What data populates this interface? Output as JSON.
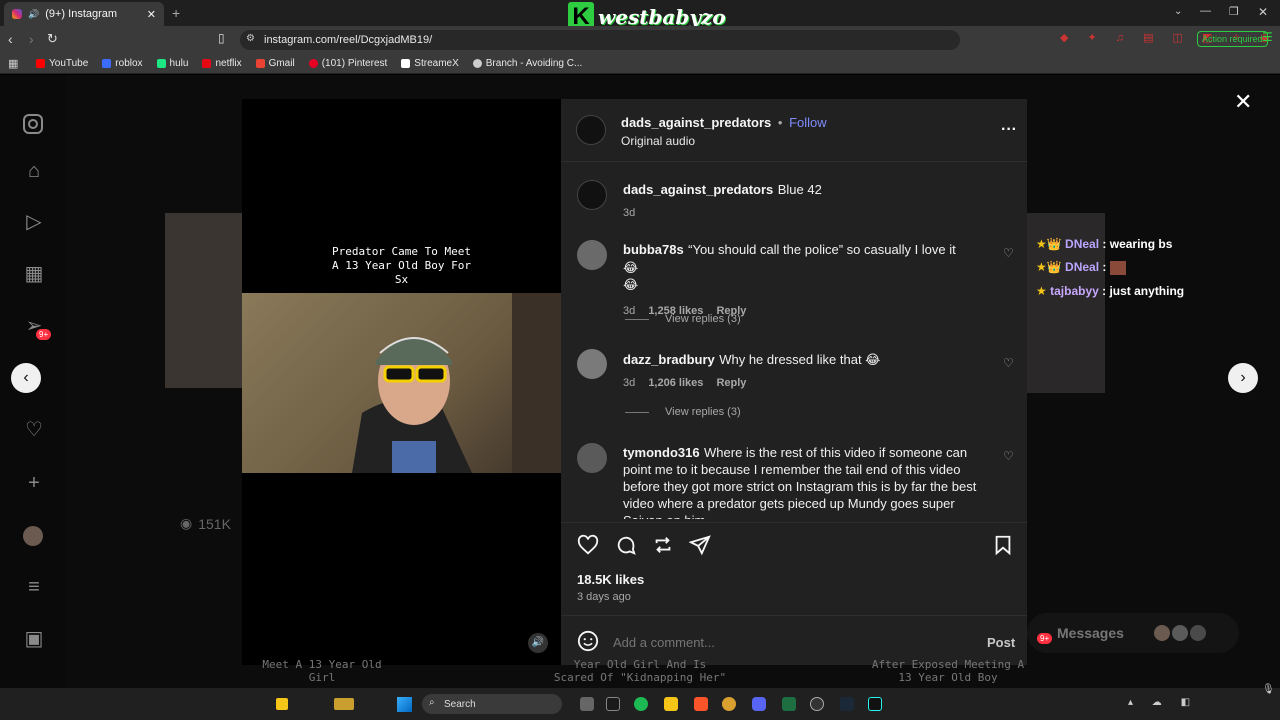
{
  "browser": {
    "tab_title": "(9+) Instagram",
    "new_tab": "+",
    "url": "instagram.com/reel/DcgxjadMB19/",
    "action_required": "Action required",
    "bookmarks": [
      {
        "label": "YouTube",
        "color": "#ff0000"
      },
      {
        "label": "roblox",
        "color": "#3b6cff"
      },
      {
        "label": "hulu",
        "color": "#1ce783"
      },
      {
        "label": "netflix",
        "color": "#e50914"
      },
      {
        "label": "Gmail",
        "color": "#ea4335"
      },
      {
        "label": "(101) Pinterest",
        "color": "#e60023"
      },
      {
        "label": "StreameX",
        "color": "#ffffff"
      },
      {
        "label": "Branch - Avoiding C...",
        "color": "#cccccc"
      }
    ]
  },
  "stream_logo": "westbabyzo",
  "instagram": {
    "notification_badge": "9+",
    "view_count": "151K",
    "video_caption": [
      "Predator Came To Meet",
      "A 13 Year Old Boy For",
      "Sx"
    ],
    "post": {
      "username": "dads_against_predators",
      "separator": "•",
      "follow": "Follow",
      "audio": "Original audio",
      "more": "···",
      "caption_user": "dads_against_predators",
      "caption_text": "Blue 42",
      "caption_time": "3d"
    },
    "comments": [
      {
        "user": "bubba78s",
        "text": "“You should call the police” so casually I love it 😂",
        "text2": "😂",
        "time": "3d",
        "likes": "1,258 likes",
        "reply": "Reply",
        "view_replies": "View replies (3)"
      },
      {
        "user": "dazz_bradbury",
        "text": "Why he dressed like that 😂",
        "time": "3d",
        "likes": "1,206 likes",
        "reply": "Reply",
        "view_replies": "View replies (3)"
      },
      {
        "user": "tymondo316",
        "text": "Where is the rest of this video if someone can point me to it because I remember the tail end of this video before they got more strict on Instagram this is by far the best video where a predator gets pieced up Mundy goes super Saiyan on him"
      }
    ],
    "likes": "18.5K likes",
    "posted": "3 days ago",
    "comment_placeholder": "Add a comment...",
    "post_button": "Post",
    "messages": "Messages",
    "messages_badge": "9+",
    "bg_captions": {
      "left": [
        "Meet A 13 Year Old",
        "Girl"
      ],
      "mid": [
        "Year Old Girl And Is",
        "Scared Of \"Kidnapping Her\""
      ],
      "right": [
        "After Exposed Meeting A",
        "13 Year Old Boy"
      ]
    }
  },
  "stream_chat": [
    {
      "user": "DNeal",
      "sep": " : ",
      "msg": "wearing bs"
    },
    {
      "user": "DNeal",
      "sep": " : ",
      "msg": ""
    },
    {
      "user": "tajbabyy",
      "sep": " : ",
      "msg": "just anything"
    }
  ],
  "taskbar": {
    "search": "Search"
  },
  "colors": {
    "follow_blue": "#7f8cff",
    "chat_user": "#b9a6ff",
    "accent_green": "#2ecc40"
  }
}
